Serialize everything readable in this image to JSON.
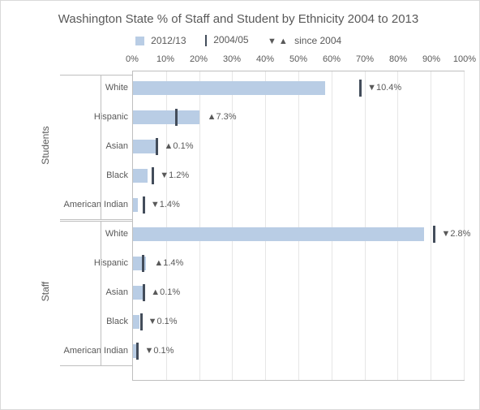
{
  "title": "Washington State % of Staff and Student by Ethnicity 2004 to 2013",
  "legend": {
    "current": "2012/13",
    "baseline": "2004/05",
    "delta": "▼ ▲ since 2004"
  },
  "axis": {
    "ticks": [
      "0%",
      "10%",
      "20%",
      "30%",
      "40%",
      "50%",
      "60%",
      "70%",
      "80%",
      "90%",
      "100%"
    ]
  },
  "groups": [
    {
      "name": "Students"
    },
    {
      "name": "Staff"
    }
  ],
  "chart_data": {
    "type": "bar",
    "title": "Washington State % of Staff and Student by Ethnicity 2004 to 2013",
    "xlabel": "",
    "ylabel": "",
    "xlim": [
      0,
      100
    ],
    "unit": "percent",
    "series": [
      {
        "name": "2012/13",
        "group": "Students",
        "points": [
          {
            "category": "White",
            "value": 58,
            "delta_dir": "down",
            "delta": "10.4%"
          },
          {
            "category": "Hispanic",
            "value": 20,
            "delta_dir": "up",
            "delta": "7.3%"
          },
          {
            "category": "Asian",
            "value": 7,
            "delta_dir": "up",
            "delta": "0.1%"
          },
          {
            "category": "Black",
            "value": 4.5,
            "delta_dir": "down",
            "delta": "1.2%"
          },
          {
            "category": "American Indian",
            "value": 1.5,
            "delta_dir": "down",
            "delta": "1.4%"
          }
        ]
      },
      {
        "name": "2004/05",
        "group": "Students",
        "points": [
          {
            "category": "White",
            "value": 68.4
          },
          {
            "category": "Hispanic",
            "value": 12.7
          },
          {
            "category": "Asian",
            "value": 6.9
          },
          {
            "category": "Black",
            "value": 5.7
          },
          {
            "category": "American Indian",
            "value": 2.9
          }
        ]
      },
      {
        "name": "2012/13",
        "group": "Staff",
        "points": [
          {
            "category": "White",
            "value": 88,
            "delta_dir": "down",
            "delta": "2.8%"
          },
          {
            "category": "Hispanic",
            "value": 4,
            "delta_dir": "up",
            "delta": "1.4%"
          },
          {
            "category": "Asian",
            "value": 3,
            "delta_dir": "up",
            "delta": "0.1%"
          },
          {
            "category": "Black",
            "value": 2,
            "delta_dir": "down",
            "delta": "0.1%"
          },
          {
            "category": "American Indian",
            "value": 1,
            "delta_dir": "down",
            "delta": "0.1%"
          }
        ]
      },
      {
        "name": "2004/05",
        "group": "Staff",
        "points": [
          {
            "category": "White",
            "value": 90.8
          },
          {
            "category": "Hispanic",
            "value": 2.6
          },
          {
            "category": "Asian",
            "value": 2.9
          },
          {
            "category": "Black",
            "value": 2.1
          },
          {
            "category": "American Indian",
            "value": 1.1
          }
        ]
      }
    ]
  }
}
